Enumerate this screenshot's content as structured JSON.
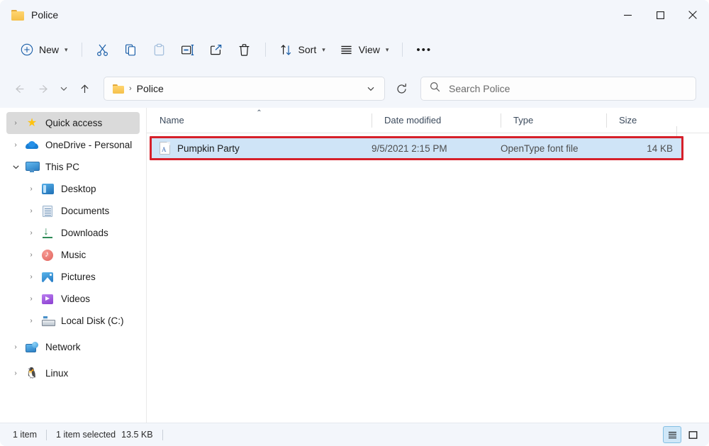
{
  "window": {
    "title": "Police",
    "folder_icon": "folder-icon",
    "controls": {
      "minimize": "minimize-icon",
      "maximize": "maximize-icon",
      "close": "close-icon"
    }
  },
  "toolbar": {
    "new_label": "New",
    "items": [
      {
        "name": "new-button",
        "label": "New",
        "icon": "plus-circle-icon",
        "disabled": false
      },
      {
        "name": "cut-button",
        "label": "Cut",
        "icon": "scissors-icon",
        "disabled": false
      },
      {
        "name": "copy-button",
        "label": "Copy",
        "icon": "copy-icon",
        "disabled": false
      },
      {
        "name": "paste-button",
        "label": "Paste",
        "icon": "clipboard-icon",
        "disabled": true
      },
      {
        "name": "rename-button",
        "label": "Rename",
        "icon": "rename-icon",
        "disabled": false
      },
      {
        "name": "share-button",
        "label": "Share",
        "icon": "share-icon",
        "disabled": false
      },
      {
        "name": "delete-button",
        "label": "Delete",
        "icon": "trash-icon",
        "disabled": false
      }
    ],
    "sort_label": "Sort",
    "view_label": "View",
    "overflow_label": "•••"
  },
  "navbar": {
    "back": "back-arrow-icon",
    "forward": "forward-arrow-icon",
    "recent": "chevron-down-icon",
    "up": "up-arrow-icon",
    "breadcrumb": {
      "folder_icon": "folder-icon",
      "separator": "›",
      "path": "Police"
    },
    "address_dropdown": "chevron-down-icon",
    "refresh": "refresh-icon"
  },
  "search": {
    "icon": "search-icon",
    "placeholder": "Search Police",
    "value": ""
  },
  "sidebar": {
    "items": [
      {
        "label": "Quick access",
        "icon": "star-icon",
        "chevron": "›",
        "expanded": false,
        "selected": true,
        "indent": false
      },
      {
        "label": "OneDrive - Personal",
        "icon": "cloud-icon",
        "chevron": "›",
        "expanded": false,
        "selected": false,
        "indent": false
      },
      {
        "label": "This PC",
        "icon": "monitor-icon",
        "chevron": "⌄",
        "expanded": true,
        "selected": false,
        "indent": false
      },
      {
        "label": "Desktop",
        "icon": "desktop-icon",
        "chevron": "›",
        "expanded": false,
        "selected": false,
        "indent": true
      },
      {
        "label": "Documents",
        "icon": "documents-icon",
        "chevron": "›",
        "expanded": false,
        "selected": false,
        "indent": true
      },
      {
        "label": "Downloads",
        "icon": "downloads-icon",
        "chevron": "›",
        "expanded": false,
        "selected": false,
        "indent": true
      },
      {
        "label": "Music",
        "icon": "music-icon",
        "chevron": "›",
        "expanded": false,
        "selected": false,
        "indent": true
      },
      {
        "label": "Pictures",
        "icon": "pictures-icon",
        "chevron": "›",
        "expanded": false,
        "selected": false,
        "indent": true
      },
      {
        "label": "Videos",
        "icon": "videos-icon",
        "chevron": "›",
        "expanded": false,
        "selected": false,
        "indent": true
      },
      {
        "label": "Local Disk (C:)",
        "icon": "disk-icon",
        "chevron": "›",
        "expanded": false,
        "selected": false,
        "indent": true
      },
      {
        "label": "Network",
        "icon": "network-icon",
        "chevron": "›",
        "expanded": false,
        "selected": false,
        "indent": false
      },
      {
        "label": "Linux",
        "icon": "linux-penguin-icon",
        "chevron": "›",
        "expanded": false,
        "selected": false,
        "indent": false
      }
    ]
  },
  "filelist": {
    "columns": [
      {
        "label": "Name",
        "sorted": "asc",
        "sort_caret": "⌃"
      },
      {
        "label": "Date modified",
        "sorted": "none",
        "sort_caret": ""
      },
      {
        "label": "Type",
        "sorted": "none",
        "sort_caret": ""
      },
      {
        "label": "Size",
        "sorted": "none",
        "sort_caret": ""
      }
    ],
    "rows": [
      {
        "name": "Pumpkin Party",
        "date_modified": "9/5/2021 2:15 PM",
        "type": "OpenType font file",
        "size": "14 KB",
        "icon": "font-file-icon",
        "selected": true,
        "highlighted": true
      }
    ]
  },
  "statusbar": {
    "item_count": "1 item",
    "selection": "1 item selected",
    "selection_size": "13.5 KB",
    "details_view": "details-view-icon",
    "icons_view": "large-icons-view-icon",
    "active_view": "details"
  },
  "colors": {
    "accent": "#0f6cbd",
    "selection_bg": "#cfe4f7",
    "annotation": "#d6202a",
    "chrome_bg": "#f3f6fb"
  }
}
